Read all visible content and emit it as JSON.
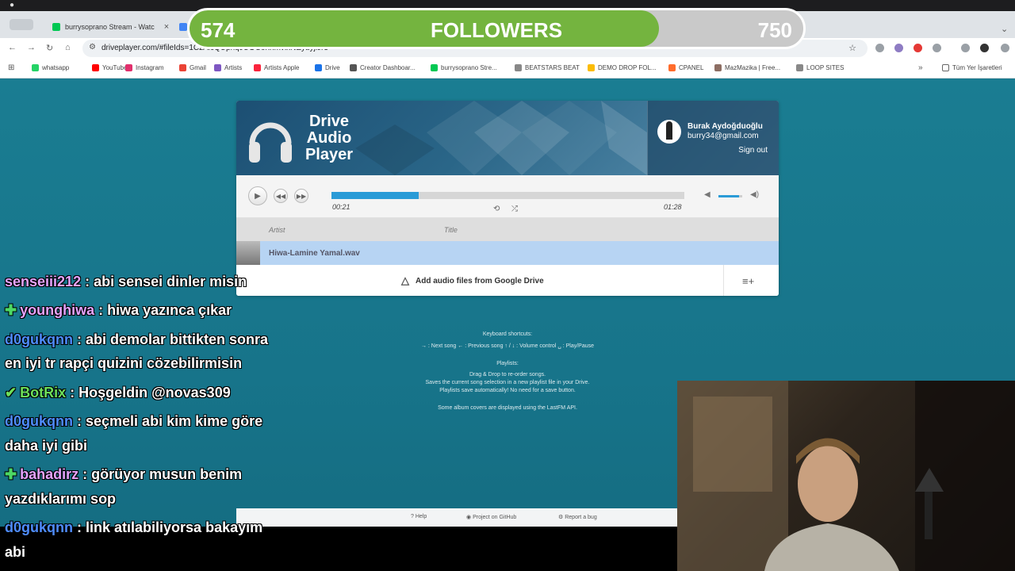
{
  "browser": {
    "tabs": [
      {
        "label": "burrysoprano Stream - Watc",
        "close": "×",
        "color": "#00c853"
      },
      {
        "label": "",
        "close": "",
        "color": "#4285f4"
      }
    ],
    "url": "driveplayer.com/#fileIds=1CzAlcQUphqJUOCohnmvixNEyuyjiJr3",
    "bookmarks": [
      {
        "label": "whatsapp",
        "color": "#25d366"
      },
      {
        "label": "YouTube",
        "color": "#ff0000"
      },
      {
        "label": "Instagram",
        "color": "#e1306c"
      },
      {
        "label": "Gmail",
        "color": "#ea4335"
      },
      {
        "label": "Artists",
        "color": "#7e57c2"
      },
      {
        "label": "Artists Apple",
        "color": "#fa243c"
      },
      {
        "label": "Drive",
        "color": "#1a73e8"
      },
      {
        "label": "Creator Dashboar...",
        "color": "#555555"
      },
      {
        "label": "burrysoprano Stre...",
        "color": "#00c853"
      },
      {
        "label": "BEATSTARS BEAT",
        "color": "#888888"
      },
      {
        "label": "DEMO DROP FOL...",
        "color": "#fbbc04"
      },
      {
        "label": "CPANEL",
        "color": "#ff6c2c"
      },
      {
        "label": "MazMazika | Free...",
        "color": "#8d6e63"
      },
      {
        "label": "LOOP SITES",
        "color": "#888888"
      }
    ],
    "all_bookmarks": "Tüm Yer İşaretleri"
  },
  "followers": {
    "current": "574",
    "label": "FOLLOWERS",
    "goal": "750",
    "progress": 0.765
  },
  "player": {
    "logo": [
      "Drive",
      "Audio",
      "Player"
    ],
    "account": {
      "name": "Burak Aydoğduoğlu",
      "email": "burry34@gmail.com",
      "sign_out": "Sign out"
    },
    "progress": 0.248,
    "elapsed": "00:21",
    "duration": "01:28",
    "volume": 0.85,
    "columns": {
      "artist": "Artist",
      "title": "Title"
    },
    "track": "Hiwa-Lamine Yamal.wav",
    "add_files": "Add audio files from Google Drive"
  },
  "help": {
    "shortcuts_title": "Keyboard shortcuts:",
    "shortcuts": "→ : Next song  ← : Previous song  ↑ / ↓ : Volume control  ␣ : Play/Pause",
    "playlists_title": "Playlists:",
    "playlists_1": "Drag & Drop to re-order songs.",
    "playlists_2": "Saves the current song selection in a new playlist file in your Drive.",
    "playlists_3": "Playlists save automatically! No need for a save button.",
    "album_note": "Some album covers are displayed using the LastFM API."
  },
  "footer": {
    "help": "Help",
    "github": "Project on GitHub",
    "report": "Report a bug"
  },
  "chat": [
    {
      "user": "senseiii212",
      "color": "#e6a4ff",
      "msg": ": abi sensei dinler misin",
      "badge": ""
    },
    {
      "user": "younghiwa",
      "color": "#e6a4ff",
      "msg": ": hiwa yazınca çıkar",
      "badge": "✚"
    },
    {
      "user": "d0gukqnn",
      "color": "#4f8dff",
      "msg": ": abi demolar bittikten sonra",
      "badge": ""
    },
    {
      "user": "",
      "color": "#ffffff",
      "msg": "en iyi tr rapçi quizini cözebilirmisin",
      "badge": ""
    },
    {
      "user": "BotRix",
      "color": "#6ee05a",
      "msg": ": Hoşgeldin @novas309",
      "badge": "✔"
    },
    {
      "user": "d0gukqnn",
      "color": "#4f8dff",
      "msg": ": seçmeli abi kim kime göre",
      "badge": ""
    },
    {
      "user": "",
      "color": "#ffffff",
      "msg": "daha iyi gibi",
      "badge": ""
    },
    {
      "user": "bahadirz",
      "color": "#e6a4ff",
      "msg": ": görüyor musun benim",
      "badge": "✚"
    },
    {
      "user": "",
      "color": "#ffffff",
      "msg": "yazdıklarımı sop",
      "badge": ""
    },
    {
      "user": "d0gukqnn",
      "color": "#4f8dff",
      "msg": ": link atılabiliyorsa bakayım",
      "badge": ""
    },
    {
      "user": "",
      "color": "#ffffff",
      "msg": "abi",
      "badge": ""
    }
  ]
}
